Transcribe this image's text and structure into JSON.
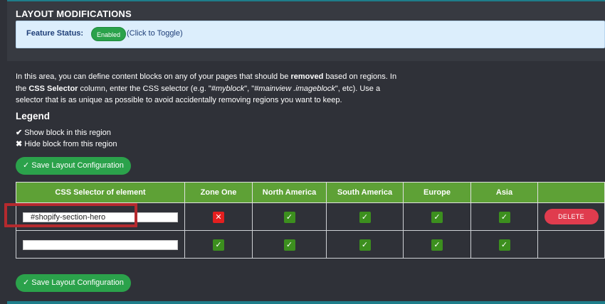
{
  "header": {
    "title": "LAYOUT MODIFICATIONS",
    "status_label": "Feature Status:",
    "status_pill": "Enabled",
    "toggle_hint": "(Click to Toggle)"
  },
  "intro": {
    "part1": "In this area, you can define content blocks on any of your pages that should be ",
    "bold1": "removed",
    "part2": " based on regions. In the ",
    "bold2": "CSS Selector",
    "part3": " column, enter the CSS selector (e.g. \"",
    "ex1": "#myblock",
    "part4": "\", \"",
    "ex2": "#mainview .imageblock",
    "part5": "\", etc). Use a selector that is as unique as possible to avoid accidentally removing regions you want to keep."
  },
  "legend": {
    "title": "Legend",
    "show_glyph": "✔",
    "show_label": "Show block in this region",
    "hide_glyph": "✖",
    "hide_label": "Hide block from this region"
  },
  "buttons": {
    "save": "✓ Save Layout Configuration",
    "delete": "DELETE"
  },
  "table": {
    "headers": [
      "CSS Selector of element",
      "Zone One",
      "North America",
      "South America",
      "Europe",
      "Asia",
      ""
    ],
    "rows": [
      {
        "selector": "#shopify-section-hero",
        "cells": [
          {
            "state": "hide",
            "glyph": "✕"
          },
          {
            "state": "show",
            "glyph": "✓"
          },
          {
            "state": "show",
            "glyph": "✓"
          },
          {
            "state": "show",
            "glyph": "✓"
          },
          {
            "state": "show",
            "glyph": "✓"
          }
        ]
      },
      {
        "selector": "",
        "cells": [
          {
            "state": "show",
            "glyph": "✓"
          },
          {
            "state": "show",
            "glyph": "✓"
          },
          {
            "state": "show",
            "glyph": "✓"
          },
          {
            "state": "show",
            "glyph": "✓"
          },
          {
            "state": "show",
            "glyph": "✓"
          }
        ]
      }
    ]
  },
  "colors": {
    "header_green": "#5ea136",
    "show_green": "#3c8f1e",
    "hide_red": "#e41f1f",
    "delete_red": "#e03c4e",
    "highlight_red": "#b52a2e"
  }
}
